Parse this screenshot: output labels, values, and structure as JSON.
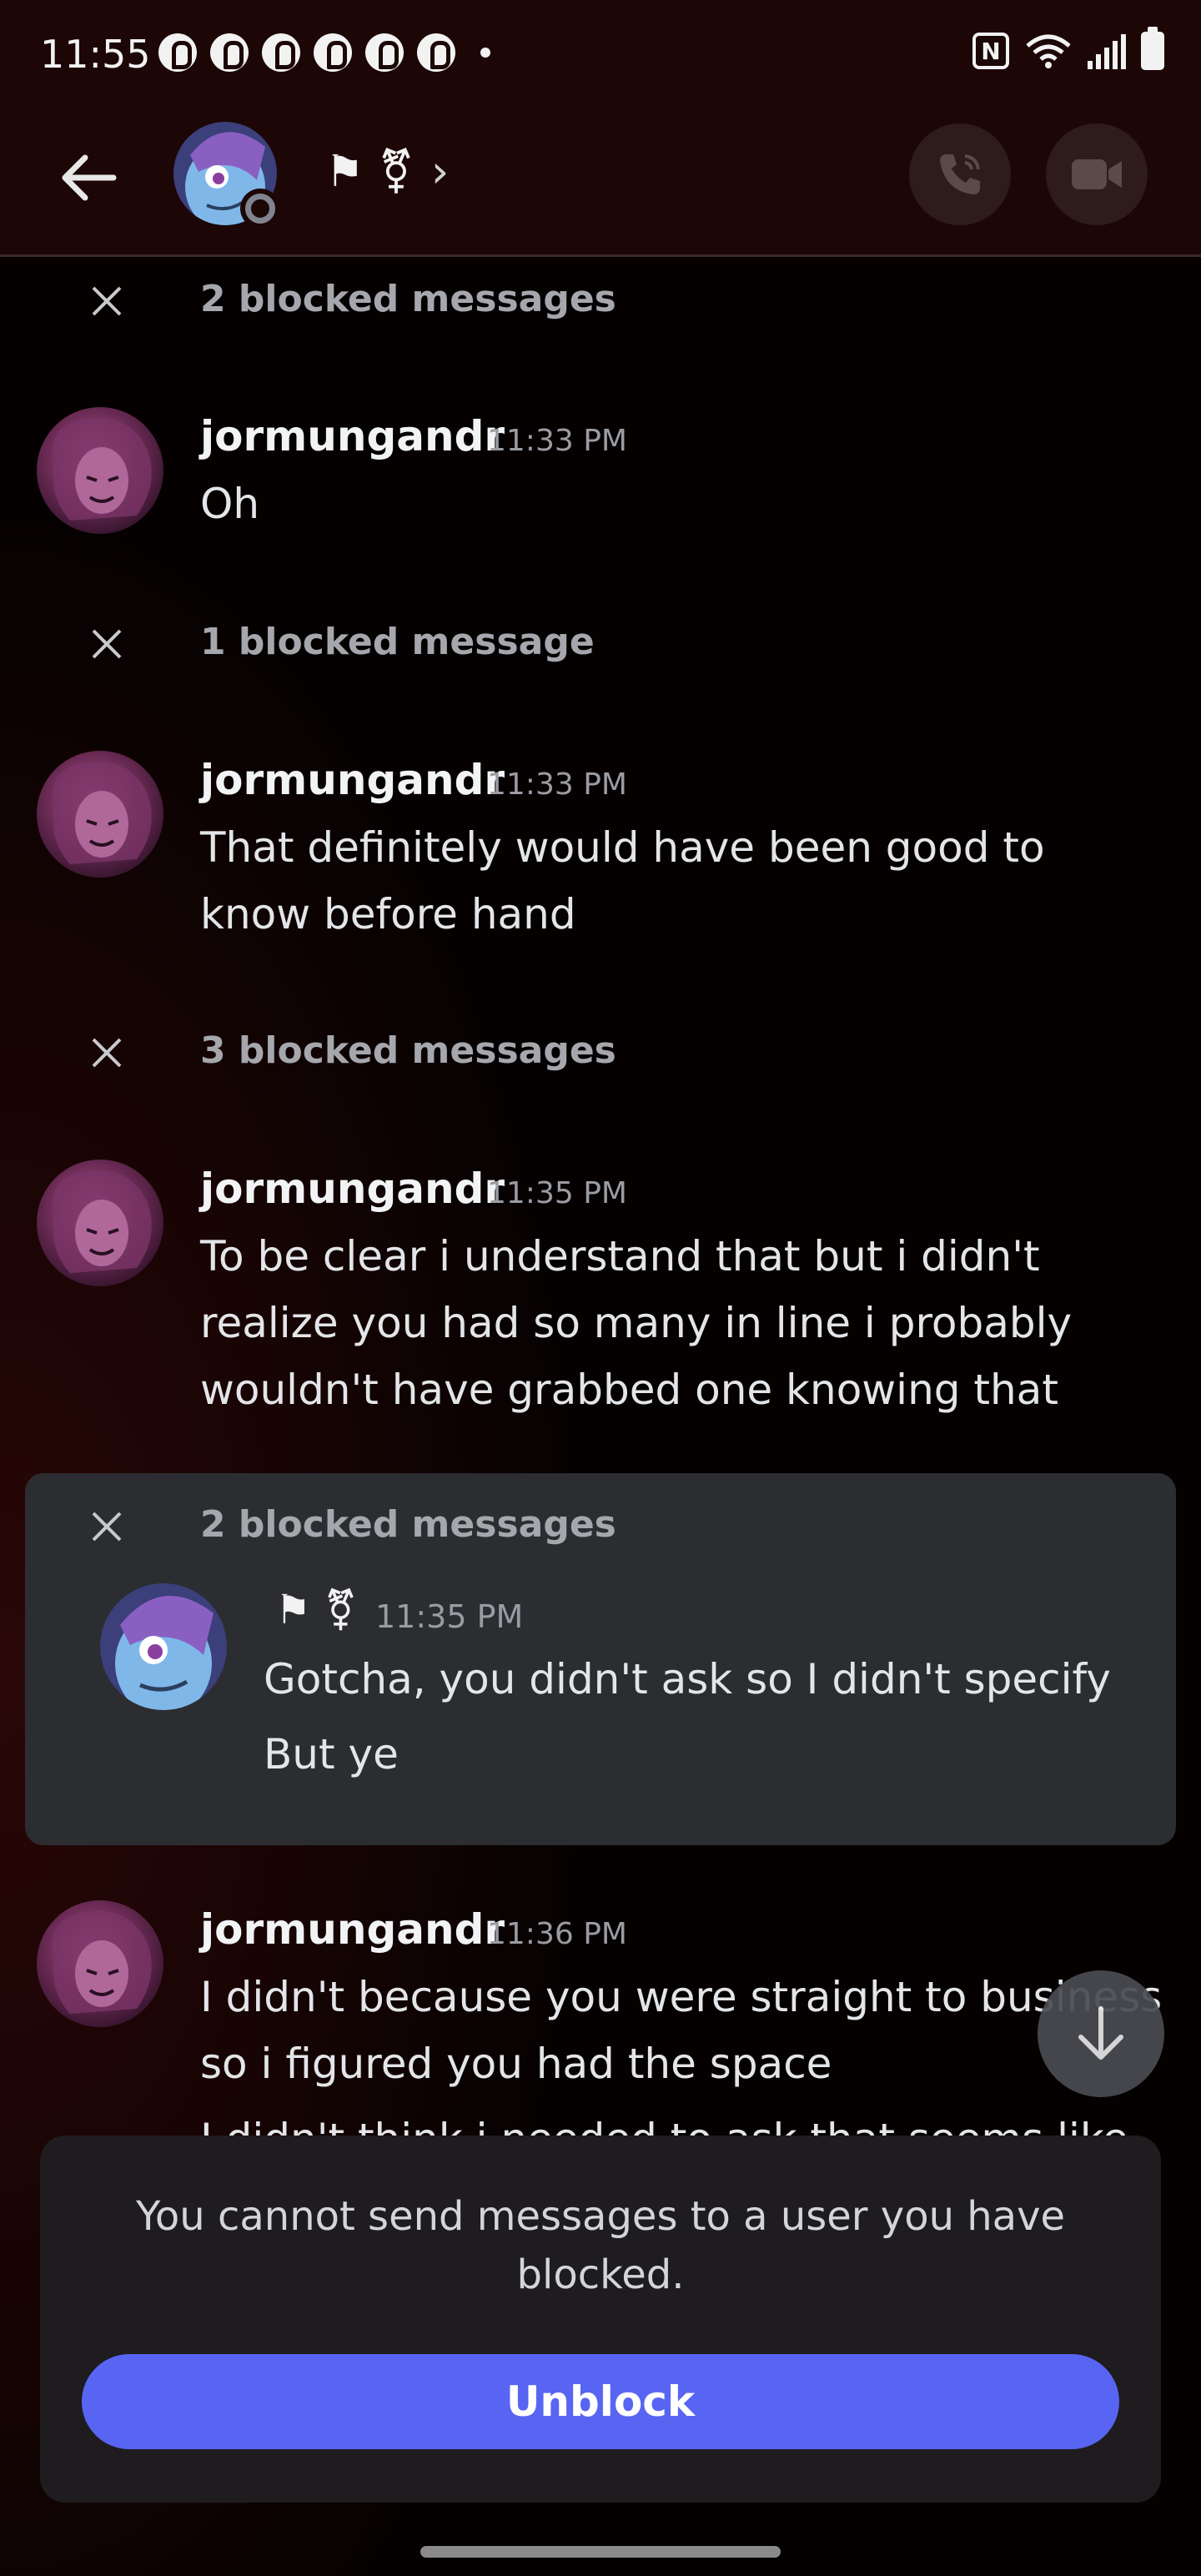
{
  "status_bar": {
    "time": "11:55",
    "notification_icons": [
      "pinterest-icon",
      "pinterest-icon",
      "pinterest-icon",
      "pinterest-icon",
      "pinterest-icon",
      "pinterest-icon"
    ],
    "right_icons": [
      "nfc-icon",
      "wifi-icon",
      "signal-icon",
      "battery-icon"
    ]
  },
  "header": {
    "flags": "⚑ ⚧",
    "chevron": "›"
  },
  "feed": {
    "blocked_1": "2 blocked messages",
    "msg_1": {
      "author": "jormungandr",
      "time": "11:33 PM",
      "text": "Oh"
    },
    "blocked_2": "1 blocked message",
    "msg_2": {
      "author": "jormungandr",
      "time": "11:33 PM",
      "text": "That definitely would have been good to know before hand"
    },
    "blocked_3": "3 blocked messages",
    "msg_3": {
      "author": "jormungandr",
      "time": "11:35 PM",
      "text": "To be clear i understand that but i didn't realize you had so many in line i probably wouldn't have grabbed one knowing that"
    },
    "blocked_card": {
      "label": "2 blocked messages",
      "flags": "⚑ ⚧",
      "time": "11:35 PM",
      "line_1": "Gotcha, you didn't ask so I didn't specify",
      "line_2": "But ye"
    },
    "msg_4": {
      "author": "jormungandr",
      "time": "11:36 PM",
      "text": "I didn't because  you were straight to business so i figured you had the space"
    },
    "cutoff": "I didn't think i needed to ask that seems like"
  },
  "blocked_panel": {
    "notice": "You cannot send messages to a user you have blocked.",
    "unblock_label": "Unblock"
  },
  "colors": {
    "accent": "#5865f2",
    "background": "#160404",
    "card": "#2b2d31"
  }
}
